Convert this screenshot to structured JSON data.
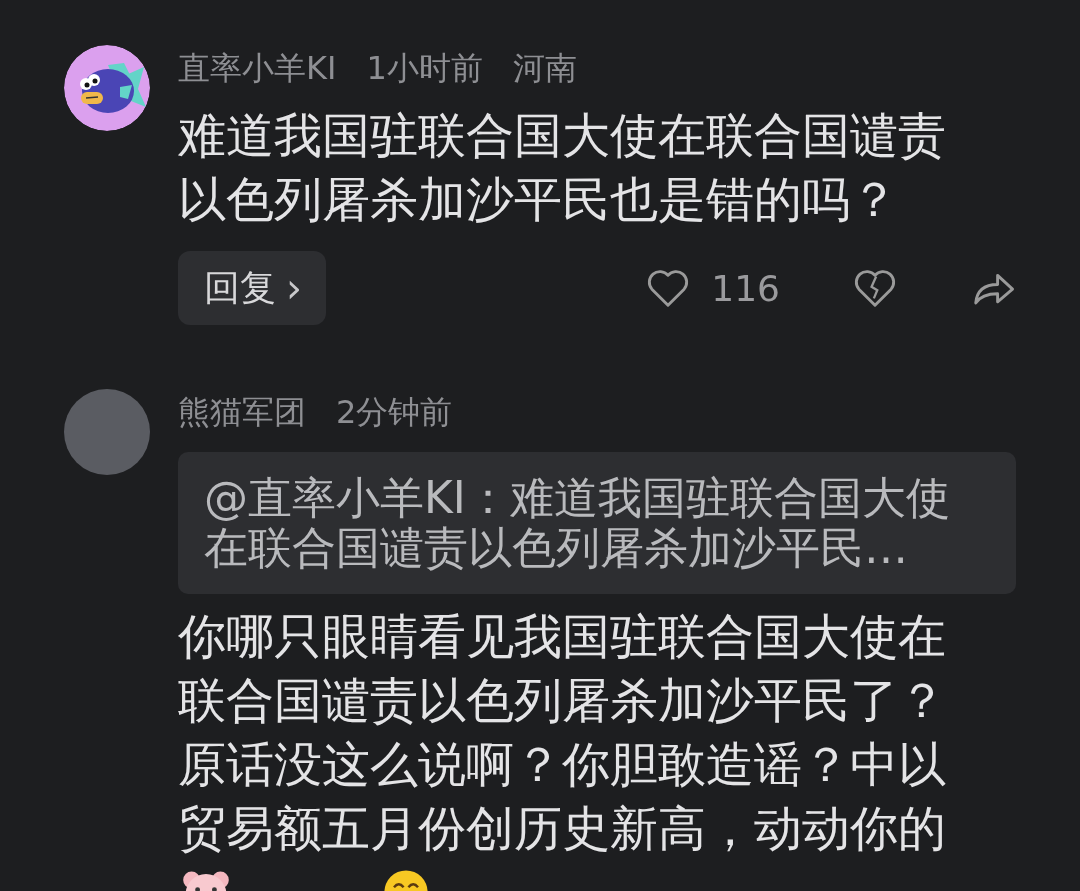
{
  "comments": [
    {
      "kind": "comment",
      "author": "直率小羊KI",
      "time": "1小时前",
      "location": "河南",
      "text": "难道我国驻联合国大使在联合国谴责以色列屠杀加沙平民也是错的吗？",
      "reply_button": "回复",
      "reply_chevron": "›",
      "likes": "116"
    },
    {
      "kind": "reply",
      "author": "熊猫军团",
      "time": "2分钟前",
      "quote": "@直率小羊KI：难道我国驻联合国大使在联合国谴责以色列屠杀加沙平民…",
      "text": "你哪只眼睛看见我国驻联合国大使在联合国谴责以色列屠杀加沙平民了？原话没这么说啊？你胆敢造谣？中以贸易额五月份创历史新高，动动你的"
    }
  ]
}
